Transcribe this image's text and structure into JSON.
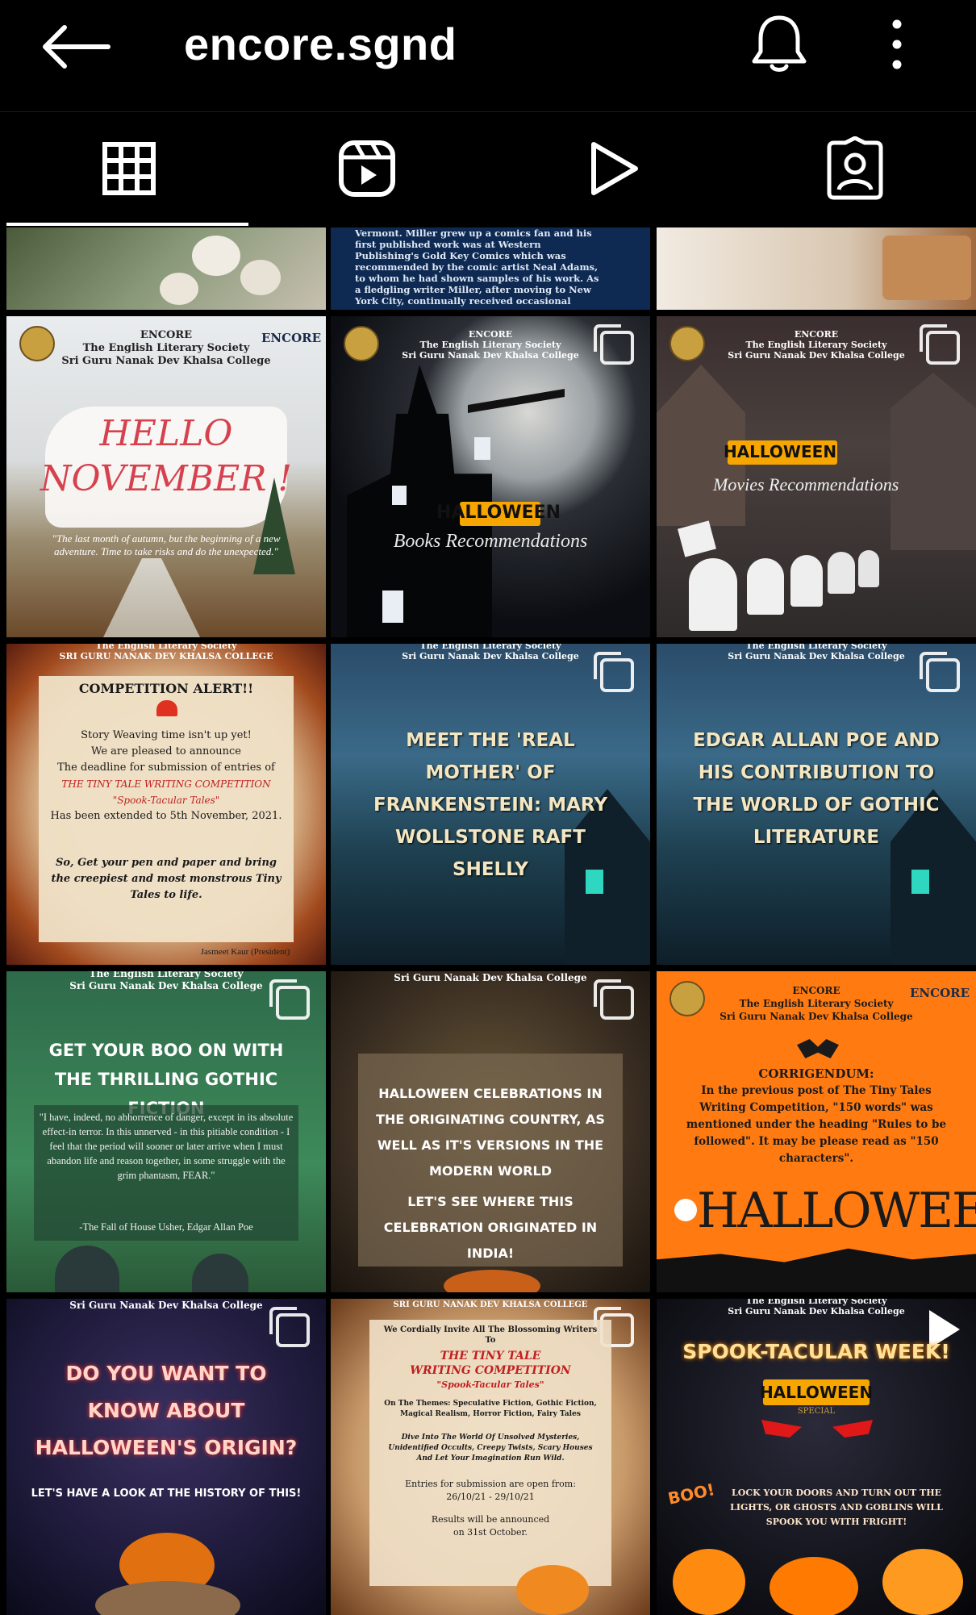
{
  "header": {
    "username": "encore.sgnd",
    "back_icon": "arrow-left-icon",
    "bell_icon": "bell-icon",
    "more_icon": "more-vertical-icon"
  },
  "tabs": [
    {
      "name": "grid",
      "icon": "grid-icon",
      "active": true
    },
    {
      "name": "reels",
      "icon": "reels-icon",
      "active": false
    },
    {
      "name": "videos",
      "icon": "play-icon",
      "active": false
    },
    {
      "name": "tagged",
      "icon": "tagged-person-icon",
      "active": false
    }
  ],
  "colors": {
    "background": "#000000",
    "foreground": "#ffffff",
    "halloween_orange": "#f7a600",
    "corrigendum_orange": "#ff7b11"
  },
  "posts": {
    "r0c1": {
      "lines": [
        "Vermont. Miller grew up a comics fan and his",
        "first published work was at Western",
        "Publishing's Gold Key Comics which was",
        "recommended by the comic artist Neal Adams,",
        "to whom he had shown samples of his work. As",
        "a fledgling writer Miller, after moving to New",
        "York City, continually received occasional"
      ]
    },
    "r1c0": {
      "org": "ENCORE",
      "society": "The English Literary Society",
      "college": "Sri Guru Nanak Dev Khalsa College",
      "logo_text": "ENCORE",
      "title1": "HELLO",
      "title2": "NOVEMBER !",
      "quote": "\"The last month of autumn, but the beginning of a new adventure. Time to take risks and do the unexpected.\""
    },
    "r1c1": {
      "org": "ENCORE",
      "society": "The English Literary Society",
      "college": "Sri Guru Nanak Dev Khalsa College",
      "banner": "HALLOWEEN",
      "subtitle": "Books Recommendations"
    },
    "r1c2": {
      "org": "ENCORE",
      "society": "The English Literary Society",
      "college": "Sri Guru Nanak Dev Khalsa College",
      "banner": "HALLOWEEN",
      "subtitle": "Movies Recommendations"
    },
    "r2c0": {
      "top1": "The English Literary Society",
      "top2": "SRI GURU NANAK DEV KHALSA COLLEGE",
      "heading": "COMPETITION ALERT!!",
      "line1": "Story Weaving time isn't up yet!",
      "line2": "We are pleased to announce",
      "line3": "The deadline for submission of entries of",
      "comp": "THE TINY TALE WRITING COMPETITION",
      "theme": "\"Spook-Tacular Tales\"",
      "line4": "Has been extended to 5th November, 2021.",
      "closing": "So, Get your pen and paper and bring the creepiest and most monstrous Tiny Tales to life.",
      "signature": "Jasmeet Kaur (President)"
    },
    "r2c1": {
      "top1": "The English Literary Society",
      "top2": "Sri Guru Nanak Dev Khalsa College",
      "title": "MEET THE 'REAL MOTHER' OF FRANKENSTEIN: MARY WOLLSTONE RAFT SHELLY"
    },
    "r2c2": {
      "top1": "The English Literary Society",
      "top2": "Sri Guru Nanak Dev Khalsa College",
      "title": "EDGAR ALLAN POE AND HIS CONTRIBUTION TO THE WORLD OF GOTHIC LITERATURE"
    },
    "r3c0": {
      "top1": "The English Literary Society",
      "top2": "Sri Guru Nanak Dev Khalsa College",
      "title": "GET YOUR BOO ON WITH THE THRILLING GOTHIC FICTION",
      "quote": "\"I have, indeed, no abhorrence of danger, except in its absolute effect-in terror. In this unnerved - in this pitiable condition - I feel that the period will sooner or later arrive when I must abandon life and reason together, in some struggle with the grim phantasm, FEAR.\"",
      "attribution": "-The Fall of House Usher, Edgar Allan Poe"
    },
    "r3c1": {
      "top": "Sri Guru Nanak Dev Khalsa College",
      "title": "HALLOWEEN CELEBRATIONS IN THE ORIGINATING COUNTRY, AS WELL AS IT'S VERSIONS IN THE MODERN WORLD",
      "sub": "LET'S SEE WHERE THIS CELEBRATION ORIGINATED IN INDIA!"
    },
    "r3c2": {
      "org": "ENCORE",
      "society": "The English Literary Society",
      "college": "Sri Guru Nanak Dev Khalsa College",
      "logo_text": "ENCORE",
      "heading": "CORRIGENDUM:",
      "body": "In the previous post of The Tiny Tales Writing Competition, \"150 words\" was mentioned under the heading \"Rules to be followed\". It may be please read as \"150 characters\".",
      "footer": "HALLOWEEN"
    },
    "r4c0": {
      "top": "Sri Guru Nanak Dev Khalsa College",
      "title": "DO YOU WANT TO KNOW ABOUT HALLOWEEN'S ORIGIN?",
      "sub": "LET'S HAVE A LOOK AT THE HISTORY OF THIS!"
    },
    "r4c1": {
      "top": "SRI GURU NANAK DEV KHALSA COLLEGE",
      "invite": "We Cordially Invite All The Blossoming Writers To",
      "comp1": "THE TINY TALE",
      "comp2": "WRITING COMPETITION",
      "theme": "\"Spook-Tacular Tales\"",
      "themes": "On The Themes: Speculative Fiction, Gothic Fiction, Magical Realism, Horror Fiction, Fairy Tales",
      "dive": "Dive Into The World Of Unsolved Mysteries, Unidentified Occults, Creepy Twists, Scary Houses And Let Your Imagination Run Wild.",
      "entries": "Entries for submission are open from:",
      "dates": "26/10/21 - 29/10/21",
      "results": "Results will be announced",
      "results_date": "on 31st October."
    },
    "r4c2": {
      "top1": "The English Literary Society",
      "top2": "Sri Guru Nanak Dev Khalsa College",
      "title": "SPOOK-TACULAR WEEK!",
      "banner": "HALLOWEEN",
      "sub_banner": "SPECIAL",
      "boo": "BOO!",
      "body": "LOCK YOUR DOORS AND TURN OUT THE LIGHTS, OR GHOSTS AND GOBLINS WILL SPOOK YOU WITH FRIGHT!"
    }
  }
}
